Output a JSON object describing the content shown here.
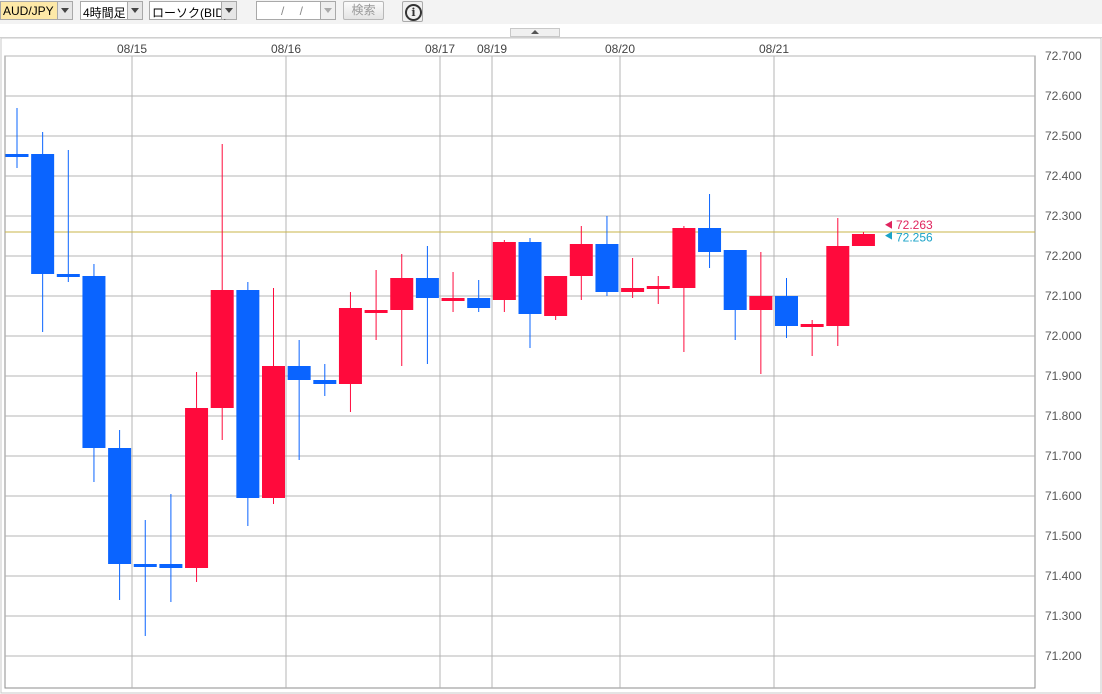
{
  "toolbar": {
    "pair": "AUD/JPY",
    "interval": "4時間足",
    "chart_type": "ローソク(BID)",
    "date_placeholder": "/ /",
    "search_label": "検索",
    "info_glyph": "i"
  },
  "colors": {
    "up": "#ff0a3c",
    "down": "#0a64ff",
    "grid": "#b4b4b4",
    "current_line": "#c8b44a",
    "ask_label": "#e0245e",
    "bid_label": "#1aa3c8"
  },
  "chart_data": {
    "type": "candlestick",
    "title": "",
    "xlabel": "",
    "ylabel": "",
    "ylim": [
      71.13,
      72.72
    ],
    "y_ticks": [
      "71.200",
      "71.300",
      "71.400",
      "71.500",
      "71.600",
      "71.700",
      "71.800",
      "71.900",
      "72.000",
      "72.100",
      "72.200",
      "72.300",
      "72.400",
      "72.500",
      "72.600",
      "72.700"
    ],
    "date_labels": [
      {
        "label": "08/15",
        "index": 5
      },
      {
        "label": "08/16",
        "index": 11
      },
      {
        "label": "08/17",
        "index": 17
      },
      {
        "label": "08/19",
        "index": 19
      },
      {
        "label": "08/20",
        "index": 24
      },
      {
        "label": "08/21",
        "index": 30
      }
    ],
    "current_price_line": 72.26,
    "price_labels": {
      "ask": "72.263",
      "bid": "72.256"
    },
    "candles": [
      {
        "o": 72.455,
        "h": 72.57,
        "l": 72.42,
        "c": 72.45
      },
      {
        "o": 72.455,
        "h": 72.51,
        "l": 72.01,
        "c": 72.155
      },
      {
        "o": 72.155,
        "h": 72.465,
        "l": 72.135,
        "c": 72.15
      },
      {
        "o": 72.15,
        "h": 72.18,
        "l": 71.635,
        "c": 71.72
      },
      {
        "o": 71.72,
        "h": 71.765,
        "l": 71.34,
        "c": 71.43
      },
      {
        "o": 71.43,
        "h": 71.54,
        "l": 71.25,
        "c": 71.425
      },
      {
        "o": 71.43,
        "h": 71.605,
        "l": 71.335,
        "c": 71.42
      },
      {
        "o": 71.42,
        "h": 71.91,
        "l": 71.385,
        "c": 71.82
      },
      {
        "o": 71.82,
        "h": 72.48,
        "l": 71.74,
        "c": 72.115
      },
      {
        "o": 72.115,
        "h": 72.135,
        "l": 71.525,
        "c": 71.595
      },
      {
        "o": 71.595,
        "h": 72.12,
        "l": 71.58,
        "c": 71.925
      },
      {
        "o": 71.925,
        "h": 71.99,
        "l": 71.69,
        "c": 71.89
      },
      {
        "o": 71.89,
        "h": 71.93,
        "l": 71.85,
        "c": 71.88
      },
      {
        "o": 71.88,
        "h": 72.11,
        "l": 71.81,
        "c": 72.07
      },
      {
        "o": 72.065,
        "h": 72.165,
        "l": 71.99,
        "c": 72.065
      },
      {
        "o": 72.065,
        "h": 72.205,
        "l": 71.925,
        "c": 72.145
      },
      {
        "o": 72.145,
        "h": 72.225,
        "l": 71.93,
        "c": 72.095
      },
      {
        "o": 72.095,
        "h": 72.16,
        "l": 72.06,
        "c": 72.095
      },
      {
        "o": 72.095,
        "h": 72.14,
        "l": 72.06,
        "c": 72.07
      },
      {
        "o": 72.09,
        "h": 72.24,
        "l": 72.06,
        "c": 72.235
      },
      {
        "o": 72.235,
        "h": 72.245,
        "l": 71.97,
        "c": 72.055
      },
      {
        "o": 72.05,
        "h": 72.15,
        "l": 72.04,
        "c": 72.15
      },
      {
        "o": 72.15,
        "h": 72.275,
        "l": 72.09,
        "c": 72.23
      },
      {
        "o": 72.23,
        "h": 72.3,
        "l": 72.1,
        "c": 72.11
      },
      {
        "o": 72.11,
        "h": 72.195,
        "l": 72.095,
        "c": 72.12
      },
      {
        "o": 72.12,
        "h": 72.15,
        "l": 72.08,
        "c": 72.125
      },
      {
        "o": 72.12,
        "h": 72.275,
        "l": 71.96,
        "c": 72.27
      },
      {
        "o": 72.27,
        "h": 72.355,
        "l": 72.17,
        "c": 72.21
      },
      {
        "o": 72.215,
        "h": 72.215,
        "l": 71.99,
        "c": 72.065
      },
      {
        "o": 72.065,
        "h": 72.21,
        "l": 71.905,
        "c": 72.1
      },
      {
        "o": 72.1,
        "h": 72.145,
        "l": 71.995,
        "c": 72.025
      },
      {
        "o": 72.025,
        "h": 72.04,
        "l": 71.95,
        "c": 72.03
      },
      {
        "o": 72.025,
        "h": 72.295,
        "l": 71.975,
        "c": 72.225
      },
      {
        "o": 72.225,
        "h": 72.26,
        "l": 72.225,
        "c": 72.255
      }
    ]
  }
}
